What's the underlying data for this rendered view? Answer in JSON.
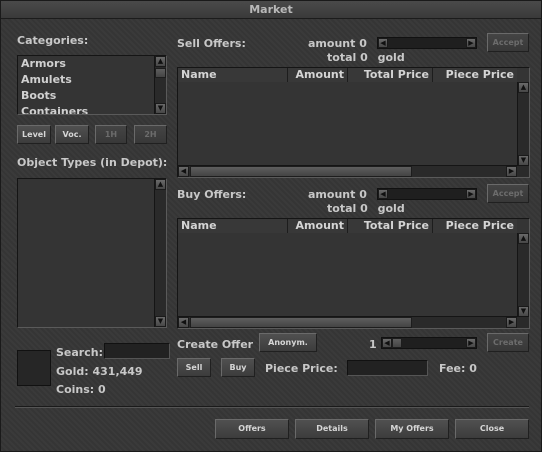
{
  "window": {
    "title": "Market"
  },
  "categories": {
    "label": "Categories:",
    "items": [
      "Armors",
      "Amulets",
      "Boots",
      "Containers"
    ]
  },
  "filters": {
    "level": "Level",
    "voc": "Voc.",
    "one_hand": "1H",
    "two_hand": "2H"
  },
  "object_types": {
    "label": "Object Types (in Depot):"
  },
  "sell_offers": {
    "label": "Sell Offers:",
    "amount_label": "amount",
    "amount_value": "0",
    "total_label": "total",
    "total_value": "0",
    "currency": "gold",
    "accept": "Accept",
    "columns": [
      "Name",
      "Amount",
      "Total Price",
      "Piece Price"
    ]
  },
  "buy_offers": {
    "label": "Buy Offers:",
    "amount_label": "amount",
    "amount_value": "0",
    "total_label": "total",
    "total_value": "0",
    "currency": "gold",
    "accept": "Accept",
    "columns": [
      "Name",
      "Amount",
      "Total Price",
      "Piece Price"
    ]
  },
  "create": {
    "label": "Create Offer",
    "anonymous": "Anonym.",
    "quantity": "1",
    "create_button": "Create",
    "sell": "Sell",
    "buy": "Buy",
    "piece_price_label": "Piece Price:",
    "piece_price_value": "",
    "fee_label": "Fee:",
    "fee_value": "0"
  },
  "account": {
    "search_label": "Search:",
    "search_value": "",
    "gold_label": "Gold:",
    "gold_value": "431,449",
    "coins_label": "Coins:",
    "coins_value": "0"
  },
  "footer": {
    "offers": "Offers",
    "details": "Details",
    "my_offers": "My Offers",
    "close": "Close"
  }
}
